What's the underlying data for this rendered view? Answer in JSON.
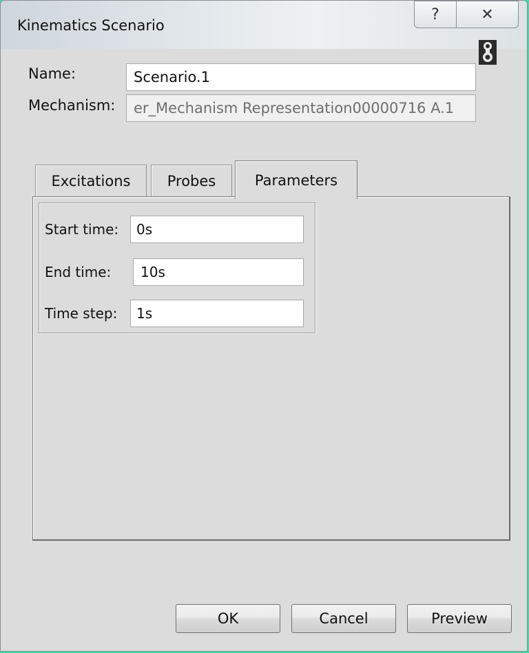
{
  "window": {
    "title": "Kinematics Scenario",
    "help_glyph": "?",
    "close_glyph": "✕"
  },
  "form": {
    "name_label": "Name:",
    "name_value": "Scenario.1",
    "mechanism_label": "Mechanism:",
    "mechanism_value": "er_Mechanism Representation00000716 A.1"
  },
  "tabs": [
    {
      "label": "Excitations",
      "active": false
    },
    {
      "label": "Probes",
      "active": false
    },
    {
      "label": "Parameters",
      "active": true
    }
  ],
  "parameters": {
    "start_time_label": "Start time:",
    "start_time_value": "0s",
    "end_time_label": "End time:",
    "end_time_value": "10s",
    "time_step_label": "Time step:",
    "time_step_value": "1s"
  },
  "buttons": {
    "ok": "OK",
    "cancel": "Cancel",
    "preview": "Preview"
  },
  "colors": {
    "desktop": "#3fd9a6",
    "dialog": "#dcdcdc"
  }
}
